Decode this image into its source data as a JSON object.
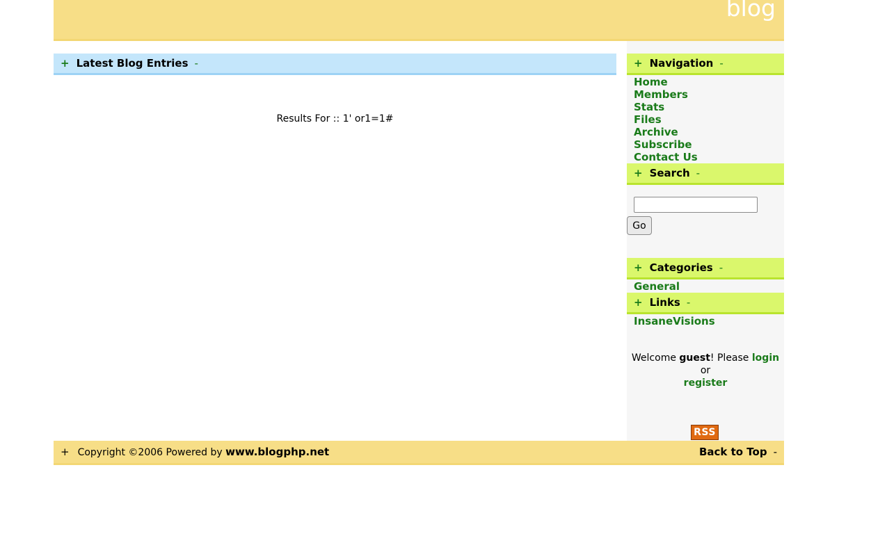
{
  "header": {
    "title": "blog"
  },
  "main": {
    "section_title": "Latest Blog Entries",
    "results_text": "Results For :: 1' or1=1#"
  },
  "sidebar": {
    "navigation": {
      "title": "Navigation",
      "items": [
        "Home",
        "Members",
        "Stats",
        "Files",
        "Archive",
        "Subscribe",
        "Contact Us"
      ]
    },
    "search": {
      "title": "Search",
      "input_value": "",
      "button_label": "Go"
    },
    "categories": {
      "title": "Categories",
      "items": [
        "General"
      ]
    },
    "links": {
      "title": "Links",
      "items": [
        "InsaneVisions"
      ]
    },
    "welcome": {
      "prefix": "Welcome ",
      "user": "guest",
      "middle": "! Please ",
      "login": "login",
      "or": " or",
      "register": "register"
    },
    "rss_label": "RSS"
  },
  "footer": {
    "copyright": "Copyright ©2006 Powered by ",
    "site": "www.blogphp.net",
    "back_to_top": "Back to Top"
  },
  "symbols": {
    "plus": "+",
    "minus": "-"
  },
  "colors": {
    "header_bg": "#f7de87",
    "blue_bar": "#c4e6fb",
    "green_bar": "#daf76c",
    "link_green": "#1a7b1a",
    "rss_orange": "#e06a12"
  }
}
